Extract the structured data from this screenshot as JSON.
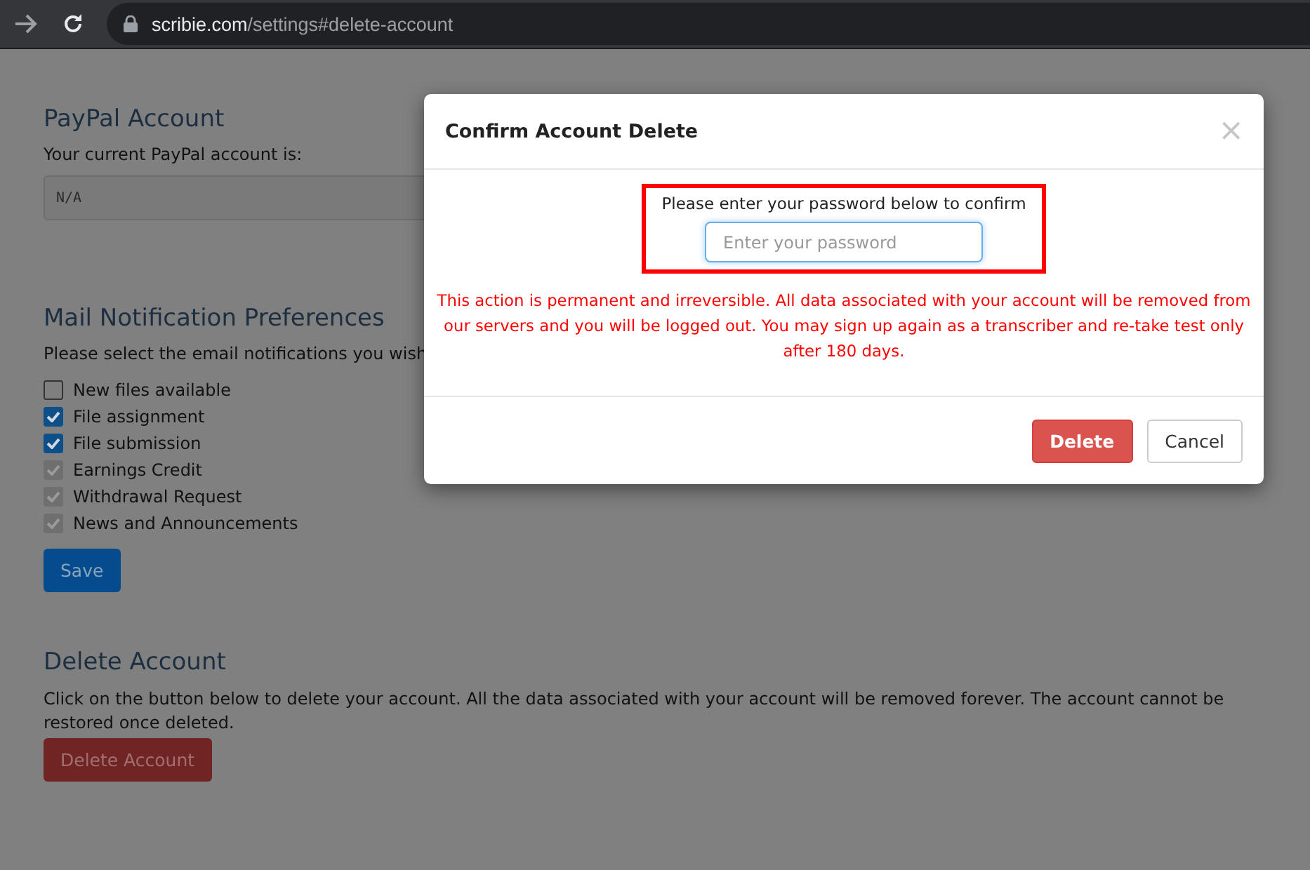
{
  "browser": {
    "url_host": "scribie.com",
    "url_path": "/settings#delete-account"
  },
  "paypal": {
    "title": "PayPal Account",
    "label": "Your current PayPal account is:",
    "value": "N/A"
  },
  "mail": {
    "title": "Mail Notification Preferences",
    "intro": "Please select the email notifications you wish",
    "options": [
      {
        "label": "New files available",
        "checked": false,
        "disabled": false
      },
      {
        "label": "File assignment",
        "checked": true,
        "disabled": false
      },
      {
        "label": "File submission",
        "checked": true,
        "disabled": false
      },
      {
        "label": "Earnings Credit",
        "checked": true,
        "disabled": true
      },
      {
        "label": "Withdrawal Request",
        "checked": true,
        "disabled": true
      },
      {
        "label": "News and Announcements",
        "checked": true,
        "disabled": true
      }
    ],
    "save": "Save"
  },
  "delete": {
    "title": "Delete Account",
    "text": "Click on the button below to delete your account. All the data associated with your account will be removed forever. The account cannot be restored once deleted.",
    "button": "Delete Account"
  },
  "modal": {
    "title": "Confirm Account Delete",
    "close": "×",
    "prompt": "Please enter your password below to confirm",
    "placeholder": "Enter your password",
    "warning": "This action is permanent and irreversible. All data associated with your account will be removed from our servers and you will be logged out. You may sign up again as a transcriber and re-take test only after 180 days.",
    "buttons": [
      {
        "label": "Delete",
        "kind": "danger"
      },
      {
        "label": "Cancel",
        "kind": "default"
      }
    ]
  }
}
